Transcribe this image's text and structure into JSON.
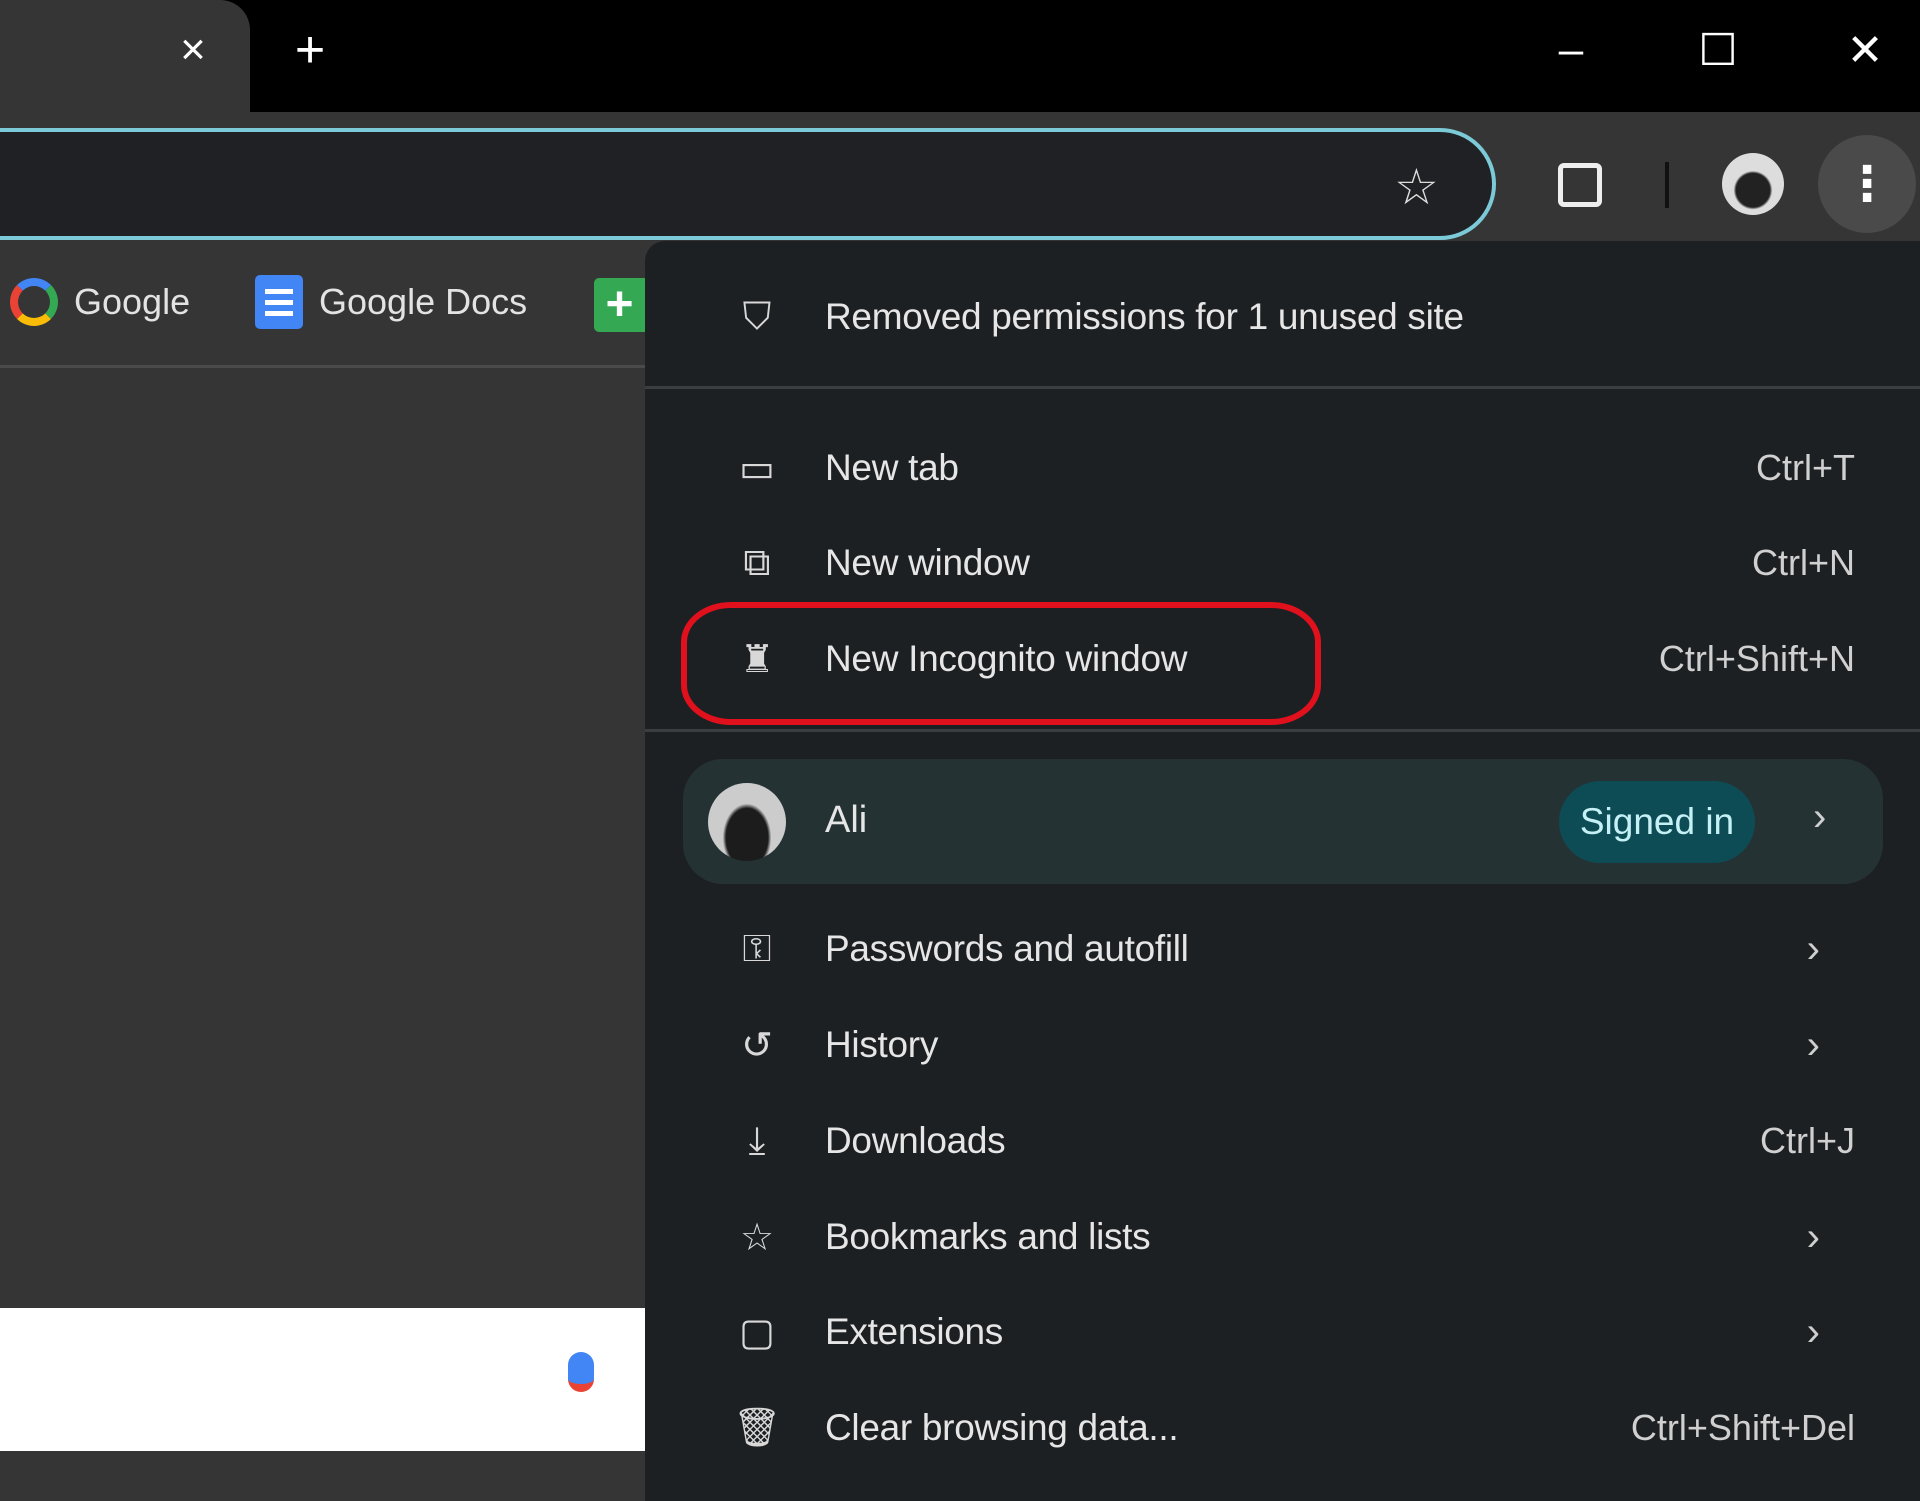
{
  "tabstrip": {
    "close_tab": "×",
    "new_tab": "+",
    "minimize": "–",
    "maximize": "☐",
    "close": "✕"
  },
  "bookmarks": [
    {
      "label": "Google",
      "icon": "google-icon"
    },
    {
      "label": "Google Docs",
      "icon": "docs-icon"
    },
    {
      "label": "",
      "icon": "sheets-icon"
    }
  ],
  "menu": {
    "notice": "Removed permissions for 1 unused site",
    "items_top": [
      {
        "label": "New tab",
        "shortcut": "Ctrl+T",
        "icon": "new-tab-icon"
      },
      {
        "label": "New window",
        "shortcut": "Ctrl+N",
        "icon": "new-window-icon"
      },
      {
        "label": "New Incognito window",
        "shortcut": "Ctrl+Shift+N",
        "icon": "incognito-icon"
      }
    ],
    "profile": {
      "name": "Ali",
      "status": "Signed in"
    },
    "items_bottom": [
      {
        "label": "Passwords and autofill",
        "icon": "key-icon"
      },
      {
        "label": "History",
        "icon": "history-icon"
      },
      {
        "label": "Downloads",
        "shortcut": "Ctrl+J",
        "icon": "download-icon"
      },
      {
        "label": "Bookmarks and lists",
        "icon": "star-icon"
      },
      {
        "label": "Extensions",
        "icon": "puzzle-icon"
      },
      {
        "label": "Clear browsing data...",
        "shortcut": "Ctrl+Shift+Del",
        "icon": "trash-icon"
      }
    ]
  },
  "colors": {
    "accent": "#7cc9d8",
    "highlight": "#e0101c",
    "chip": "#0d4c55"
  }
}
